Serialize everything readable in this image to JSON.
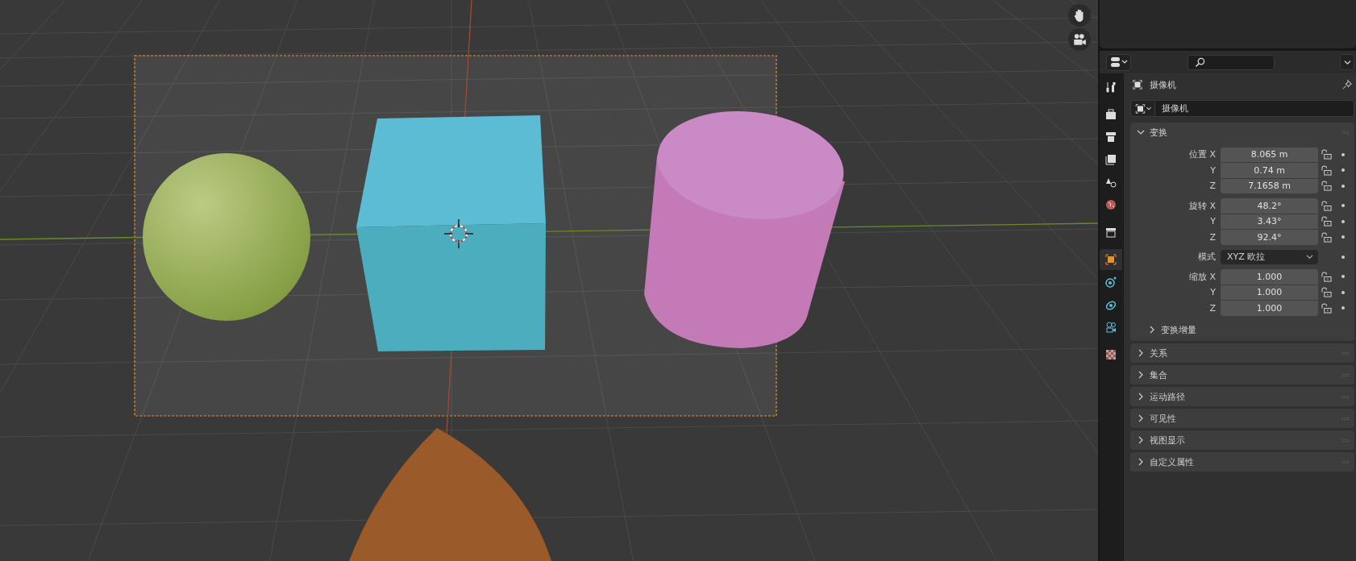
{
  "properties": {
    "context_title": "摄像机",
    "object_name": "摄像机",
    "property_tabs": [
      {
        "kind": "tool",
        "selected": false
      },
      {
        "kind": "render",
        "selected": false
      },
      {
        "kind": "output",
        "selected": false
      },
      {
        "kind": "view_layer",
        "selected": false
      },
      {
        "kind": "scene",
        "selected": false
      },
      {
        "kind": "world",
        "selected": false
      },
      {
        "kind": "collection",
        "selected": false
      },
      {
        "kind": "object",
        "selected": true
      },
      {
        "kind": "physics",
        "selected": false
      },
      {
        "kind": "constraint",
        "selected": false
      },
      {
        "kind": "camera_data",
        "selected": false
      },
      {
        "kind": "texture",
        "selected": false
      }
    ],
    "transform": {
      "title": "变换",
      "expanded": true,
      "rows": [
        {
          "kind": "vector",
          "label": "位置",
          "fields": [
            {
              "axis": "X",
              "value": "8.065 m",
              "locked": false
            },
            {
              "axis": "Y",
              "value": "0.74 m",
              "locked": false
            },
            {
              "axis": "Z",
              "value": "7.1658 m",
              "locked": false
            }
          ]
        },
        {
          "kind": "vector",
          "label": "旋转",
          "fields": [
            {
              "axis": "X",
              "value": "48.2°",
              "locked": false
            },
            {
              "axis": "Y",
              "value": "3.43°",
              "locked": false
            },
            {
              "axis": "Z",
              "value": "92.4°",
              "locked": false
            }
          ]
        },
        {
          "kind": "dropdown",
          "label": "模式",
          "value": "XYZ 欧拉"
        },
        {
          "kind": "vector",
          "label": "缩放",
          "fields": [
            {
              "axis": "X",
              "value": "1.000",
              "locked": false
            },
            {
              "axis": "Y",
              "value": "1.000",
              "locked": false
            },
            {
              "axis": "Z",
              "value": "1.000",
              "locked": false
            }
          ]
        }
      ],
      "subsection": {
        "title": "变换增量",
        "expanded": false
      }
    },
    "panels": [
      {
        "title": "关系",
        "expanded": false
      },
      {
        "title": "集合",
        "expanded": false
      },
      {
        "title": "运动路径",
        "expanded": false
      },
      {
        "title": "可见性",
        "expanded": false
      },
      {
        "title": "视图显示",
        "expanded": false
      },
      {
        "title": "自定义属性",
        "expanded": false
      }
    ]
  }
}
